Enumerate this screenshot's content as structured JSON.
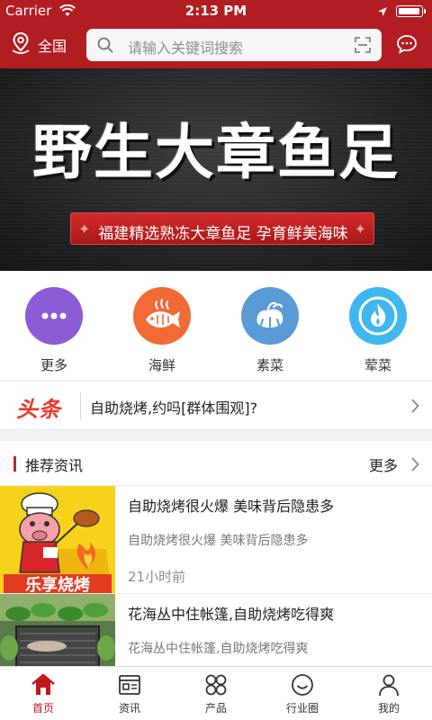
{
  "status_bar": {
    "carrier": "Carrier",
    "time": "2:13 PM"
  },
  "header": {
    "region": "全国",
    "search_placeholder": "请输入关键词搜索",
    "brand_color": "#b21d22"
  },
  "banner": {
    "title": "野生大章鱼足",
    "subtitle": "福建精选熟冻大章鱼足 孕育鲜美海味"
  },
  "categories": [
    {
      "label": "更多",
      "icon": "more-dots-icon",
      "color": "#8b5cd6"
    },
    {
      "label": "海鲜",
      "icon": "fish-icon",
      "color": "#f26a36"
    },
    {
      "label": "素菜",
      "icon": "vegetable-icon",
      "color": "#5b9bd5"
    },
    {
      "label": "荤菜",
      "icon": "flame-icon",
      "color": "#3fb7ee"
    }
  ],
  "headline": {
    "logo": "头条",
    "text": "自助烧烤,约吗[群体围观]?"
  },
  "section": {
    "title": "推荐资讯",
    "more": "更多",
    "items": [
      {
        "title": "自助烧烤很火爆 美味背后隐患多",
        "summary": "自助烧烤很火爆 美味背后隐患多",
        "time": "21小时前",
        "thumb_text": "乐享烧烤"
      },
      {
        "title": "花海丛中住帐篷,自助烧烤吃得爽",
        "summary": "花海丛中住帐篷,自助烧烤吃得爽"
      }
    ]
  },
  "tabbar": {
    "tabs": [
      {
        "label": "首页",
        "icon": "home-icon",
        "active": true
      },
      {
        "label": "资讯",
        "icon": "news-icon"
      },
      {
        "label": "产品",
        "icon": "grid-icon"
      },
      {
        "label": "行业圈",
        "icon": "circle-smile-icon"
      },
      {
        "label": "我的",
        "icon": "person-icon"
      }
    ],
    "active_color": "#c3161b"
  }
}
